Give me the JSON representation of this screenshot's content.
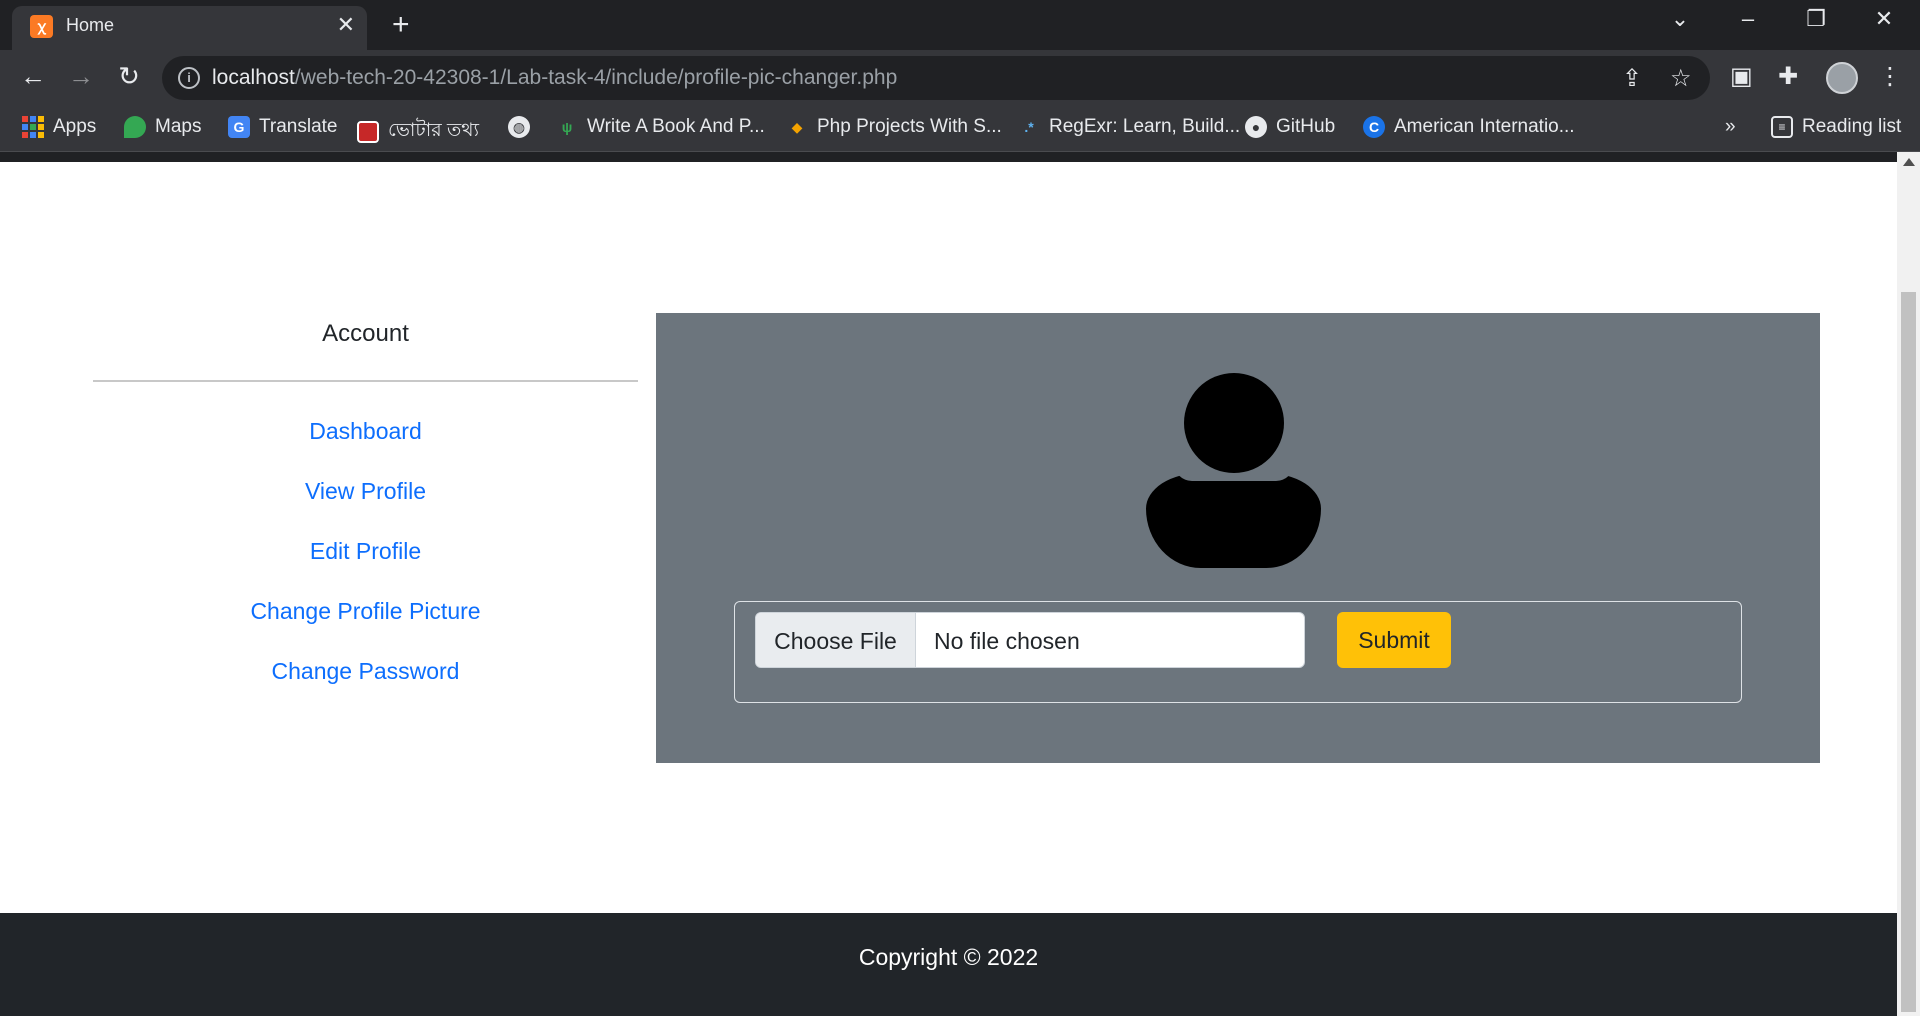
{
  "browser": {
    "tab_title": "Home",
    "tab_favicon": "xampp-icon",
    "close_tab": "✕",
    "new_tab": "+",
    "window_controls": {
      "tab_search": "⌄",
      "minimize": "–",
      "restore": "❐",
      "close": "✕"
    },
    "url_host": "localhost",
    "url_path": "/web-tech-20-42308-1/Lab-task-4/include/profile-pic-changer.php",
    "bookmarks": [
      {
        "label": "Apps",
        "icon": "apps-grid-icon"
      },
      {
        "label": "Maps",
        "icon": "maps-pin-icon"
      },
      {
        "label": "Translate",
        "icon": "translate-icon"
      },
      {
        "label": "ভোটার তথ্য",
        "icon": "voter-info-icon"
      },
      {
        "label": "",
        "icon": "globe-icon"
      },
      {
        "label": "Write A Book And P...",
        "icon": "book-icon"
      },
      {
        "label": "Php Projects With S...",
        "icon": "php-projects-icon"
      },
      {
        "label": "RegExr: Learn, Build...",
        "icon": "regexr-icon"
      },
      {
        "label": "GitHub",
        "icon": "github-icon"
      },
      {
        "label": "American Internatio...",
        "icon": "aiub-icon"
      }
    ],
    "more_bookmarks": "»",
    "reading_list": "Reading list"
  },
  "page": {
    "sidebar": {
      "title": "Account",
      "links": [
        {
          "label": "Dashboard"
        },
        {
          "label": "View Profile"
        },
        {
          "label": "Edit Profile"
        },
        {
          "label": "Change Profile Picture"
        },
        {
          "label": "Change Password"
        }
      ]
    },
    "upload": {
      "choose_file_label": "Choose File",
      "file_status": "No file chosen",
      "submit_label": "Submit"
    },
    "footer": {
      "copyright": "Copyright © 2022"
    }
  },
  "colors": {
    "panel_bg": "#6c757d",
    "link": "#0d6efd",
    "submit_bg": "#ffc107",
    "footer_bg": "#212529"
  }
}
